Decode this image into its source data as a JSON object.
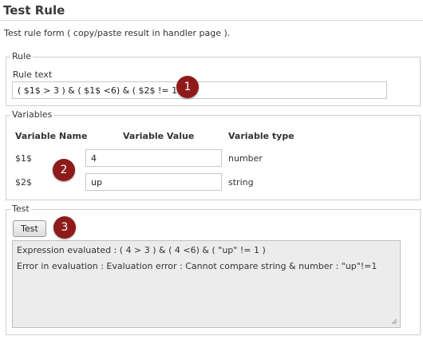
{
  "page": {
    "title": "Test Rule",
    "description": "Test rule form ( copy/paste result in handler page )."
  },
  "rule_section": {
    "legend": "Rule",
    "rule_text_label": "Rule text",
    "rule_text_value": "( $1$ > 3 ) & ( $1$ <6) & ( $2$ != 1 )"
  },
  "variables_section": {
    "legend": "Variables",
    "headers": [
      "Variable Name",
      "Variable Value",
      "Variable type"
    ],
    "rows": [
      {
        "name": "$1$",
        "value": "4",
        "type": "number"
      },
      {
        "name": "$2$",
        "value": "up",
        "type": "string"
      }
    ]
  },
  "test_section": {
    "legend": "Test",
    "button_label": "Test",
    "result_lines": [
      "Expression evaluated : ( 4 > 3 ) & ( 4 <6) & ( \"up\" != 1 )",
      "Error in evaluation : Evaluation error : Cannot compare string & number : \"up\"!=1"
    ]
  },
  "badges": [
    "1",
    "2",
    "3"
  ],
  "colors": {
    "badge": "#8e1a1a",
    "result_background": "#ececec",
    "border": "#cfcfcf"
  },
  "icons": {
    "resize_handle": "resize-grip-icon"
  }
}
